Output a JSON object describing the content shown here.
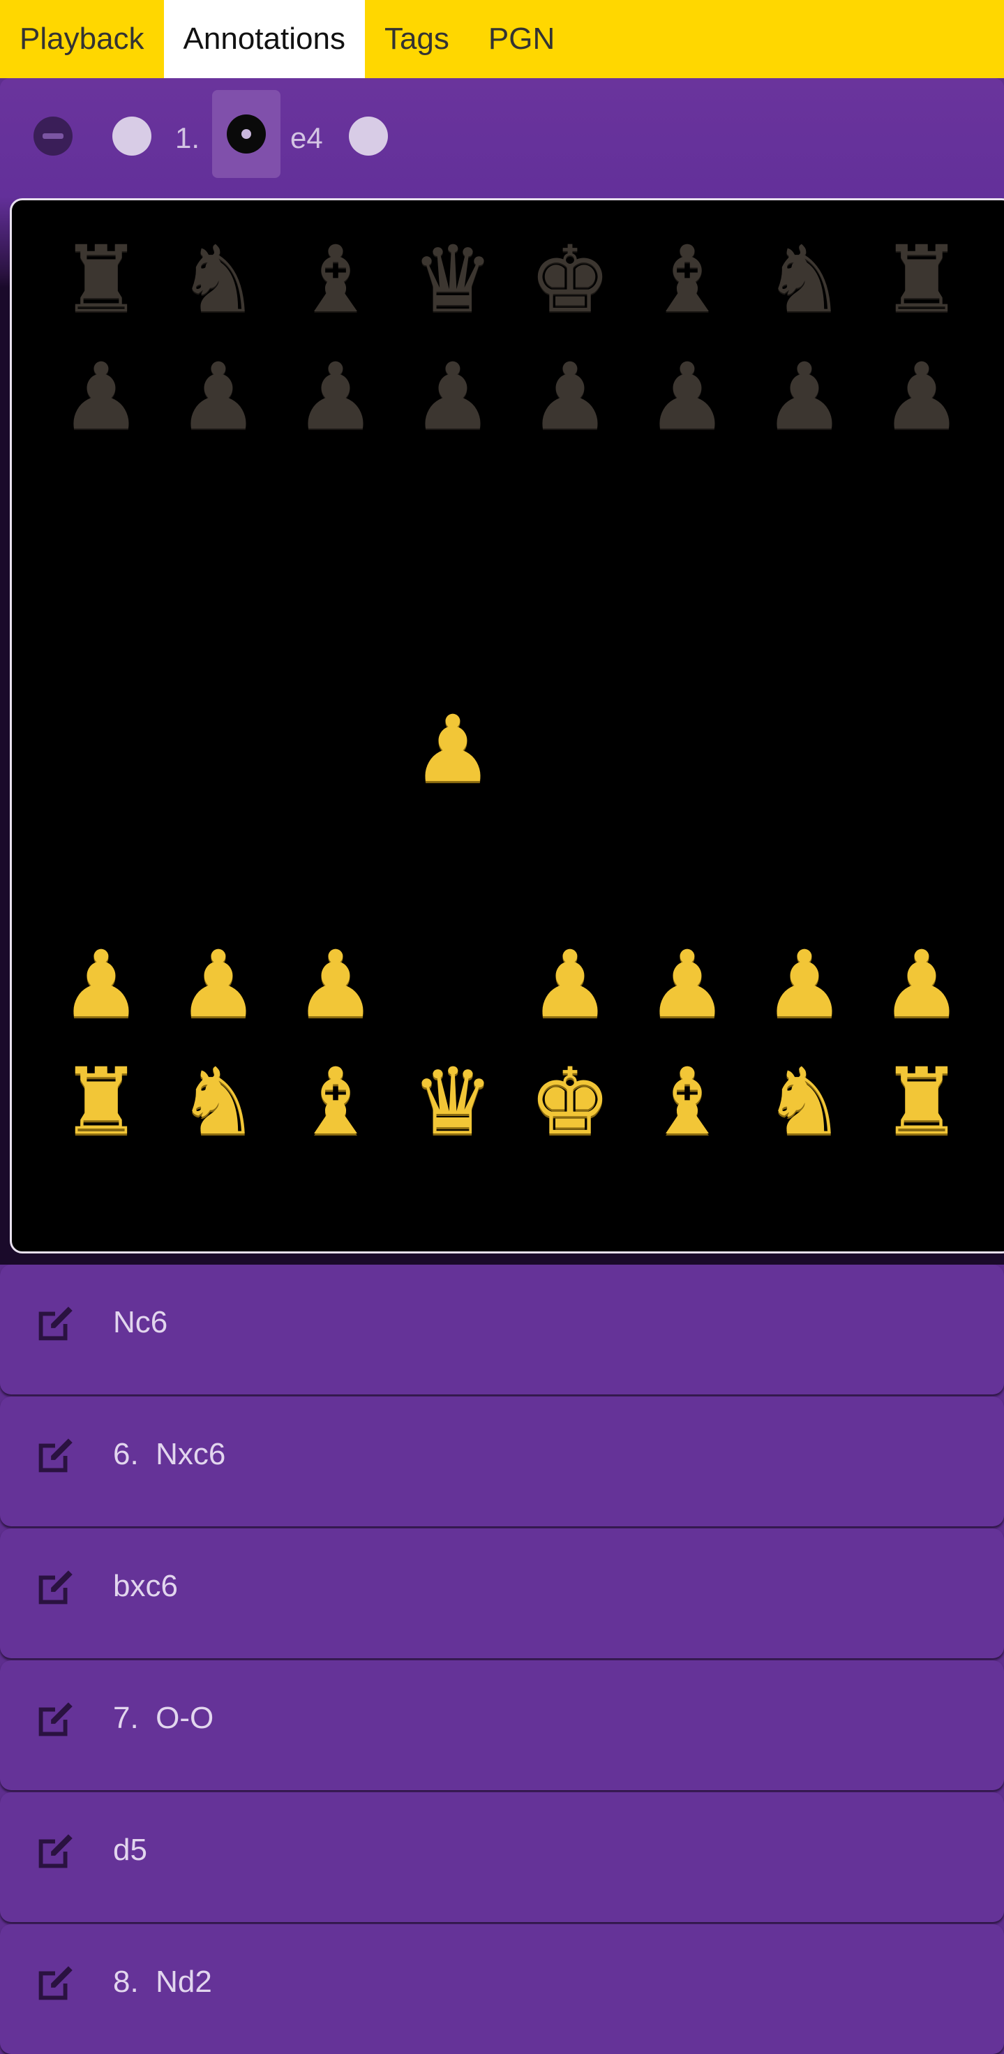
{
  "tabs": [
    "Playback",
    "Annotations",
    "Tags",
    "PGN"
  ],
  "active_tab": "Annotations",
  "move_nav": {
    "move_number": "1.",
    "move": "e4"
  },
  "board": {
    "black_back": [
      "♜",
      "♞",
      "♝",
      "♛",
      "♚",
      "♝",
      "♞",
      "♜"
    ],
    "black_pawns": [
      "♟",
      "♟",
      "♟",
      "♟",
      "♟",
      "♟",
      "♟",
      "♟"
    ],
    "white_pawn_advanced": "♟",
    "white_pawns": [
      "♟",
      "♟",
      "♟",
      "",
      "♟",
      "♟",
      "♟",
      "♟"
    ],
    "white_back": [
      "♜",
      "♞",
      "♝",
      "♛",
      "♚",
      "♝",
      "♞",
      "♜"
    ]
  },
  "moves": [
    {
      "text": "Nc6"
    },
    {
      "text": "6.  Nxc6"
    },
    {
      "text": "bxc6"
    },
    {
      "text": "7.  O-O"
    },
    {
      "text": "d5"
    },
    {
      "text": "8.  Nd2"
    }
  ]
}
